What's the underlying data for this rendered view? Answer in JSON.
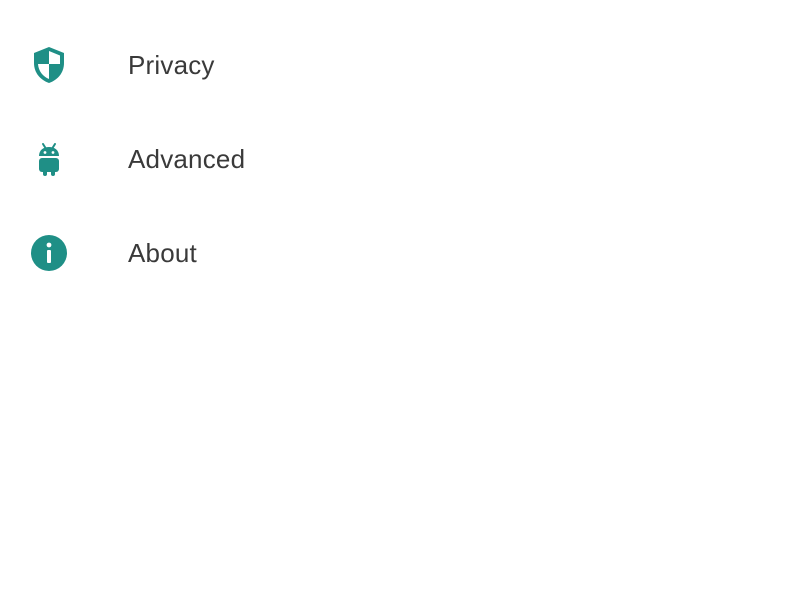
{
  "theme": {
    "accent": "#1f8f86",
    "text": "#3a3a3a",
    "background": "#ffffff"
  },
  "settings": {
    "items": [
      {
        "label": "Privacy",
        "icon": "shield-icon"
      },
      {
        "label": "Advanced",
        "icon": "android-icon"
      },
      {
        "label": "About",
        "icon": "info-icon"
      }
    ]
  }
}
